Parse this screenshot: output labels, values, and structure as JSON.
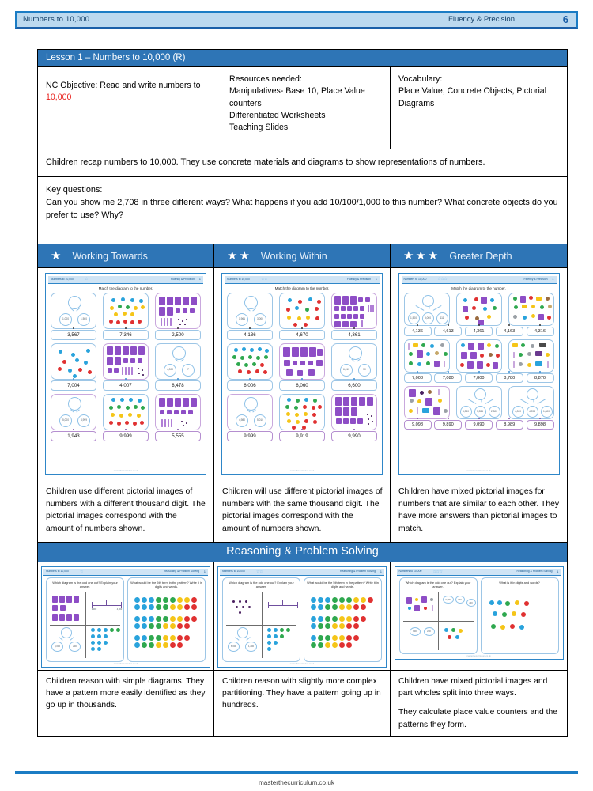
{
  "header": {
    "title": "Numbers to 10,000",
    "section": "Fluency & Precision",
    "page_number": "6"
  },
  "lesson": {
    "heading": "Lesson 1 – Numbers to 10,000 (R)",
    "objective_label": "NC Objective: Read and write numbers to ",
    "objective_value": "10,000",
    "resources_label": "Resources needed:",
    "resources": "Manipulatives- Base 10, Place Value counters\nDifferentiated Worksheets\nTeaching Slides",
    "vocabulary_label": "Vocabulary:",
    "vocabulary": "Place Value, Concrete Objects, Pictorial Diagrams",
    "overview": "Children recap numbers to 10,000. They use concrete materials and diagrams to show representations of numbers.",
    "key_questions_label": "Key questions:",
    "key_questions": "Can you show me 2,708 in three different ways? What happens if you add 10/100/1,000 to this number? What concrete objects do you prefer to use? Why?"
  },
  "differentiation": {
    "columns": [
      {
        "label": "Working Towards",
        "stars": 1
      },
      {
        "label": "Working Within",
        "stars": 2
      },
      {
        "label": "Greater Depth",
        "stars": 3
      }
    ],
    "descriptions": [
      "Children use different pictorial images of numbers with a different thousand digit. The pictorial images correspond with the amount of numbers shown.",
      "Children will use different pictorial images of numbers with the same thousand digit. The pictorial images correspond with the amount of numbers shown.",
      "Children have mixed pictorial images for numbers that are similar to each other. They have more answers than pictorial images to match."
    ]
  },
  "worksheets": [
    {
      "header_title": "Numbers to 10,000",
      "header_section": "Fluency & Precision",
      "page_number": "1",
      "stars": "☆",
      "instruction": "Match the diagram to the number.",
      "footer": "masterthecurriculum.co.uk",
      "rows": [
        {
          "numbers": [
            "3,567",
            "7,346",
            "2,500"
          ]
        },
        {
          "numbers": [
            "7,004",
            "4,007",
            "8,478"
          ]
        },
        {
          "numbers": [
            "1,943",
            "9,999",
            "5,555"
          ]
        }
      ],
      "part_whole_labels": [
        [
          "1,000",
          "1,500"
        ],
        [
          "4,000",
          "7"
        ],
        [
          "5,000",
          "4,999"
        ]
      ]
    },
    {
      "header_title": "Numbers to 10,000",
      "header_section": "Fluency & Precision",
      "page_number": "1",
      "stars": "☆☆",
      "instruction": "Match the diagram to the number.",
      "footer": "masterthecurriculum.co.uk",
      "rows": [
        {
          "numbers": [
            "4,136",
            "4,670",
            "4,361"
          ]
        },
        {
          "numbers": [
            "6,006",
            "6,060",
            "6,600"
          ]
        },
        {
          "numbers": [
            "9,999",
            "9,919",
            "9,990"
          ]
        }
      ],
      "part_whole_labels": [
        [
          "1,961",
          "3,000"
        ],
        [
          "6,010",
          "50"
        ],
        [
          "4,980",
          "5,010"
        ]
      ]
    },
    {
      "header_title": "Numbers to 10,000",
      "header_section": "Fluency & Precision",
      "page_number": "1",
      "stars": "☆☆☆",
      "instruction": "Match the diagram to the number.",
      "footer": "masterthecurriculum.co.uk",
      "rows": [
        {
          "numbers": [
            "4,136",
            "4,613",
            "4,361",
            "4,163",
            "4,316"
          ]
        },
        {
          "numbers": [
            "7,008",
            "7,080",
            "7,800",
            "8,780",
            "8,870"
          ]
        },
        {
          "numbers": [
            "9,098",
            "9,890",
            "9,090",
            "8,989",
            "9,898"
          ]
        }
      ],
      "part_whole_labels": [
        [
          "1,500",
          "3,000",
          "111"
        ],
        [
          "3,330",
          "3,336",
          "2,300"
        ],
        [
          "4,000",
          "4,098",
          "1,800"
        ]
      ]
    }
  ],
  "reasoning": {
    "heading": "Reasoning & Problem Solving",
    "thumbnails": [
      {
        "header_title": "Numbers to 10,000",
        "header_section": "Reasoning & Problem Solving",
        "page_number": "1",
        "stars": "☆",
        "question_left": "Which diagram is the odd one out? Explain your answer.",
        "question_right": "What would be the 5th term in the pattern? Write it in digits and words.",
        "part_whole_labels": [
          "8,000",
          "200"
        ],
        "footer": "masterthecurriculum.co.uk"
      },
      {
        "header_title": "Numbers to 10,000",
        "header_section": "Reasoning & Problem Solving",
        "page_number": "1",
        "stars": "☆☆",
        "question_left": "Which diagram is the odd one out? Explain your answer.",
        "question_right": "What would be the 5th term in the pattern? Write it in digits and words.",
        "part_whole_labels": [
          "8,000",
          "1,200"
        ],
        "footer": "masterthecurriculum.co.uk"
      },
      {
        "header_title": "Numbers to 10,000",
        "header_section": "Reasoning & Problem Solving",
        "page_number": "1",
        "stars": "☆☆☆",
        "question_left": "Which diagram is the odd one out? Explain your answer.",
        "question_right": "What is it in digits and words?",
        "part_whole_labels": [
          "2,739",
          "900",
          "200"
        ],
        "footer": "masterthecurriculum.co.uk"
      }
    ],
    "descriptions": [
      "Children reason with simple diagrams. They have a pattern more easily identified as they go up in thousands.",
      "Children reason with slightly more complex partitioning. They have a pattern going up in hundreds.",
      "Children have mixed pictorial images and part wholes split into three ways."
    ],
    "description_3_extra": "They calculate place value counters and the patterns they form."
  },
  "footer": "masterthecurriculum.co.uk",
  "colors": {
    "brand_blue": "#2e75b6",
    "banner_light": "#bcd9ef",
    "accent_red": "#e8211c"
  }
}
